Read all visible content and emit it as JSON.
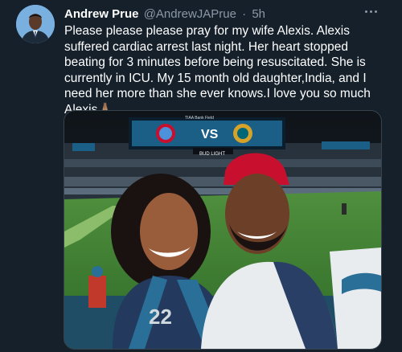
{
  "tweet": {
    "author_name": "Andrew Prue",
    "handle": "@AndrewJAPrue",
    "separator": "·",
    "timestamp": "5h",
    "text": "Please please please pray for my wife Alexis. Alexis suffered cardiac arrest last night. Her heart stopped beating for 3 minutes before being resuscitated. She is currently in ICU. My 15 month old daughter,India, and I need her more than she ever knows.I love you so much Alexis🙏🏽",
    "more_icon": "more-horizontal-icon"
  },
  "photo": {
    "scoreboard_vs": "VS",
    "stadium_name": "TIAA Bank Field",
    "banner_text": "BUD LIGHT",
    "jersey_number": "22"
  },
  "colors": {
    "background": "#15202b",
    "secondary_text": "#8b98a5",
    "border": "#38444d"
  }
}
